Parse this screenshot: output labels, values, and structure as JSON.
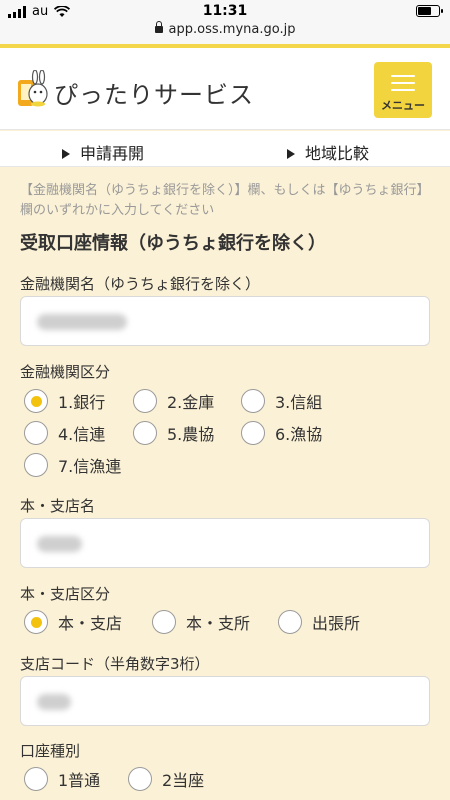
{
  "status_bar": {
    "carrier": "au",
    "time": "11:31",
    "battery_level": 0.7
  },
  "browser": {
    "url": "app.oss.myna.go.jp"
  },
  "header": {
    "site_title": "ぴったりサービス",
    "menu_label": "メニュー"
  },
  "subnav": {
    "items": [
      {
        "label": "申請再開"
      },
      {
        "label": "地域比較"
      }
    ]
  },
  "form": {
    "note": "【金融機関名（ゆうちょ銀行を除く）】欄、もしくは【ゆうちょ銀行】欄のいずれかに入力してください",
    "section_title": "受取口座情報（ゆうちょ銀行を除く）",
    "bank_name": {
      "label": "金融機関名（ゆうちょ銀行を除く）",
      "value": ""
    },
    "bank_type": {
      "label": "金融機関区分",
      "options": [
        "1.銀行",
        "2.金庫",
        "3.信組",
        "4.信連",
        "5.農協",
        "6.漁協",
        "7.信漁連"
      ],
      "selected": "1.銀行"
    },
    "branch_name": {
      "label": "本・支店名",
      "value": ""
    },
    "branch_type": {
      "label": "本・支店区分",
      "options": [
        "本・支店",
        "本・支所",
        "出張所"
      ],
      "selected": "本・支店"
    },
    "branch_code": {
      "label": "支店コード（半角数字3桁）",
      "value": ""
    },
    "account_type": {
      "label": "口座種別",
      "options": [
        "1普通",
        "2当座"
      ],
      "selected": ""
    }
  },
  "colors": {
    "accent": "#f2d43e",
    "background": "#fbf1d6",
    "radio_selected": "#f2c20f"
  }
}
